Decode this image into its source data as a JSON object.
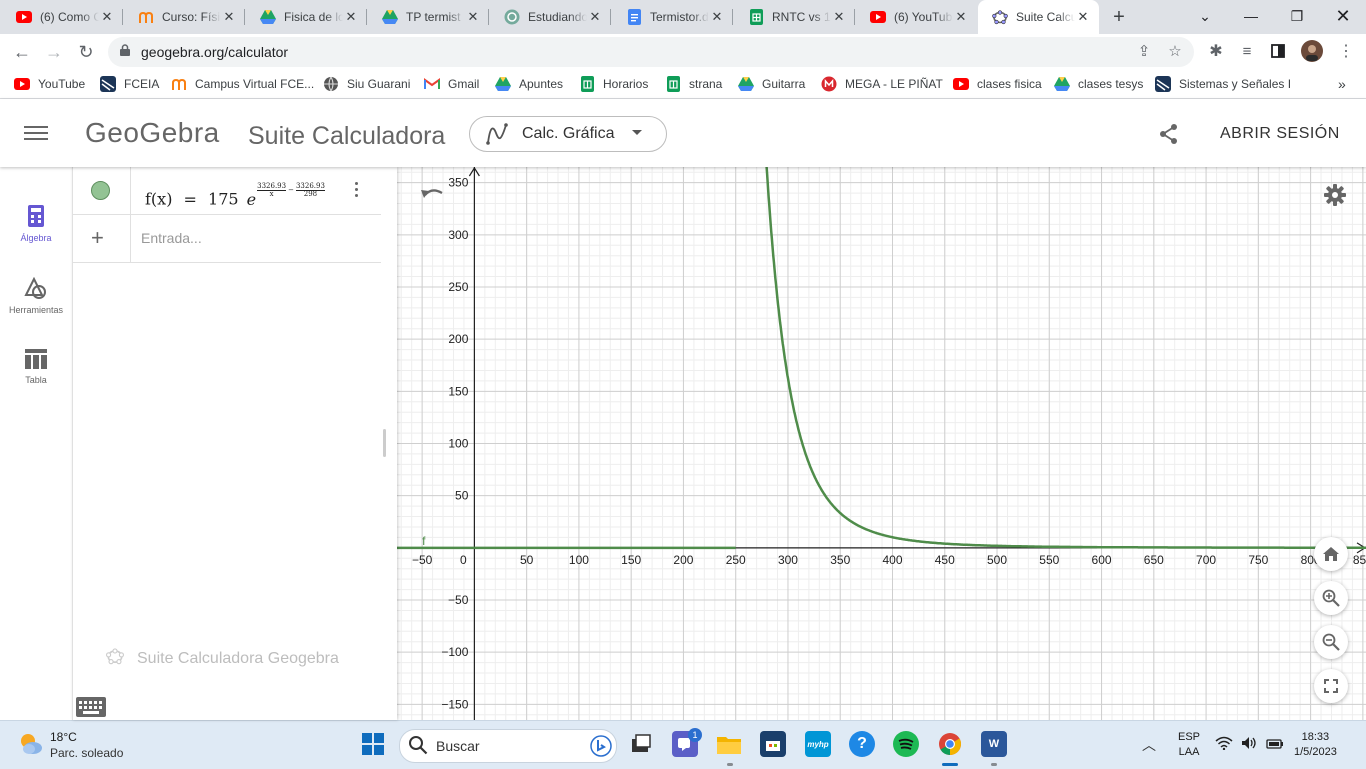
{
  "browser": {
    "tabs": [
      {
        "title": "(6) Como C",
        "icon": "youtube-icon",
        "color": "#ff0000"
      },
      {
        "title": "Curso: Físic",
        "icon": "moodle-icon",
        "color": "#f98012"
      },
      {
        "title": "Fisica de lo",
        "icon": "google-drive-icon",
        "color": "#1fa463"
      },
      {
        "title": "TP termist",
        "icon": "google-drive-icon",
        "color": "#1fa463"
      },
      {
        "title": "Estudiando",
        "icon": "chatgpt-icon",
        "color": "#74aa9c"
      },
      {
        "title": "Termistor.d",
        "icon": "google-docs-icon",
        "color": "#4285f4"
      },
      {
        "title": "RNTC vs 1/",
        "icon": "google-sheets-icon",
        "color": "#0f9d58"
      },
      {
        "title": "(6) YouTub",
        "icon": "youtube-icon",
        "color": "#ff0000"
      },
      {
        "title": "Suite Calcu",
        "icon": "geogebra-icon",
        "color": "#666666",
        "active": true
      }
    ],
    "url": "geogebra.org/calculator",
    "bookmarks": [
      {
        "label": "YouTube",
        "icon": "youtube-icon"
      },
      {
        "label": "FCEIA",
        "icon": "fceia-icon"
      },
      {
        "label": "Campus Virtual FCE...",
        "icon": "moodle-icon"
      },
      {
        "label": "Siu Guarani",
        "icon": "globe-icon"
      },
      {
        "label": "Gmail",
        "icon": "gmail-icon"
      },
      {
        "label": "Apuntes",
        "icon": "google-drive-icon"
      },
      {
        "label": "Horarios",
        "icon": "google-sheets-icon"
      },
      {
        "label": "strana",
        "icon": "google-sheets-icon"
      },
      {
        "label": "Guitarra",
        "icon": "google-drive-icon"
      },
      {
        "label": "MEGA - LE PIÑAT",
        "icon": "mega-icon"
      },
      {
        "label": "clases fisica",
        "icon": "youtube-icon"
      },
      {
        "label": "clases tesys",
        "icon": "google-drive-icon"
      },
      {
        "label": "Sistemas y Señales I",
        "icon": "fceia-icon"
      }
    ],
    "more_bookmarks": "»"
  },
  "app": {
    "logo_text": "GeoGebra",
    "suite_title": "Suite Calculadora",
    "app_selector": "Calc. Gráfica",
    "signin": "ABRIR SESIÓN",
    "left_tools": [
      {
        "label": "Álgebra",
        "icon": "calculator-icon",
        "active": true
      },
      {
        "label": "Herramientas",
        "icon": "shapes-icon"
      },
      {
        "label": "Tabla",
        "icon": "table-icon"
      }
    ]
  },
  "algebra": {
    "function_lhs": "f(x)",
    "equals": "=",
    "coef": "175",
    "base": "e",
    "exp_num1": "3326.93",
    "exp_den1": "x",
    "exp_minus": "−",
    "exp_num2": "3326.93",
    "exp_den2": "298",
    "input_placeholder": "Entrada...",
    "brand_footer": "Suite Calculadora Geogebra",
    "dot_color": "#93c394"
  },
  "chart_data": {
    "type": "line",
    "function": "f(x) = 175 e^(3326.93/x − 3326.93/298)",
    "series": [
      {
        "name": "f",
        "color": "#4f8c4a",
        "amplitude": 175,
        "B": 3326.93,
        "T0": 298
      }
    ],
    "x_ticks": [
      -50,
      0,
      50,
      100,
      150,
      200,
      250,
      300,
      350,
      400,
      450,
      500,
      550,
      600,
      650,
      700,
      750,
      800,
      850
    ],
    "y_ticks": [
      -150,
      -100,
      -50,
      50,
      100,
      150,
      200,
      250,
      300,
      350
    ],
    "xlim": [
      -75,
      853
    ],
    "ylim": [
      -165,
      365
    ],
    "grid": true,
    "curve_label": "f"
  },
  "taskbar": {
    "weather_temp": "18°C",
    "weather_desc": "Parc. soleado",
    "search_label": "Buscar",
    "lang_1": "ESP",
    "lang_2": "LAA",
    "time": "18:33",
    "date": "1/5/2023",
    "teams_badge": "1"
  }
}
